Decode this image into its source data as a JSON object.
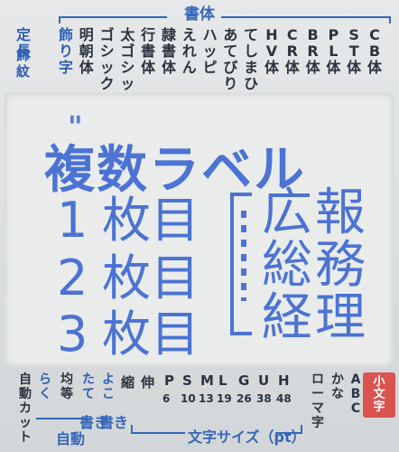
{
  "header": {
    "title": "書体",
    "left_labels": [
      "定長",
      "飾紋"
    ],
    "modes": [
      [
        "飾",
        "り",
        "字"
      ],
      [
        "明",
        "朝",
        "体"
      ],
      [
        "ゴ",
        "シ",
        "ッ",
        "ク"
      ],
      [
        "太",
        "ゴ",
        "シ",
        "ッ",
        "ク"
      ],
      [
        "行",
        "書",
        "体"
      ],
      [
        "隷",
        "書",
        "体"
      ],
      [
        "え",
        "れ",
        "ん"
      ],
      [
        "ハ",
        "ッ",
        "ピ"
      ],
      [
        "あ",
        "て",
        "び",
        "り"
      ],
      [
        "て",
        "し",
        "ま",
        "ひ"
      ],
      [
        "H",
        "V",
        "体"
      ],
      [
        "C",
        "R",
        "体"
      ],
      [
        "B",
        "R",
        "体"
      ],
      [
        "P",
        "L",
        "体"
      ],
      [
        "S",
        "T",
        "体"
      ],
      [
        "C",
        "B",
        "体"
      ]
    ]
  },
  "lcd": {
    "marker": "\"",
    "line1": "複数ラベル",
    "rows": [
      {
        "num": "1",
        "text": "枚目"
      },
      {
        "num": "2",
        "text": "枚目"
      },
      {
        "num": "3",
        "text": "枚目"
      }
    ],
    "col_a": [
      "広",
      "総",
      "経"
    ],
    "col_b": [
      "報",
      "務",
      "理"
    ]
  },
  "bottom": {
    "left_modes": [
      [
        "自",
        "動",
        "カ",
        "ッ",
        "ト"
      ],
      [
        "ら",
        "く"
      ],
      [
        "均",
        "等"
      ],
      [
        "た",
        "て"
      ],
      [
        "よ",
        "こ"
      ]
    ],
    "auto_label": "自動",
    "tate_label": "書き",
    "yoko_label": "書き",
    "sizes": [
      {
        "top": "縮",
        "pt": ""
      },
      {
        "top": "伸",
        "pt": ""
      },
      {
        "top": "P",
        "pt": "6"
      },
      {
        "top": "S",
        "pt": "10"
      },
      {
        "top": "M",
        "pt": "13"
      },
      {
        "top": "L",
        "pt": "19"
      },
      {
        "top": "G",
        "pt": "26"
      },
      {
        "top": "U",
        "pt": "38"
      },
      {
        "top": "H",
        "pt": "48"
      }
    ],
    "roman": [
      "ロ",
      "ー",
      "マ",
      "字"
    ],
    "kana": [
      "か",
      "な"
    ],
    "abc": [
      "A",
      "B",
      "C"
    ],
    "small_label": [
      "小",
      "文",
      "字"
    ],
    "size_caption": "文字サイズ（pt）"
  }
}
